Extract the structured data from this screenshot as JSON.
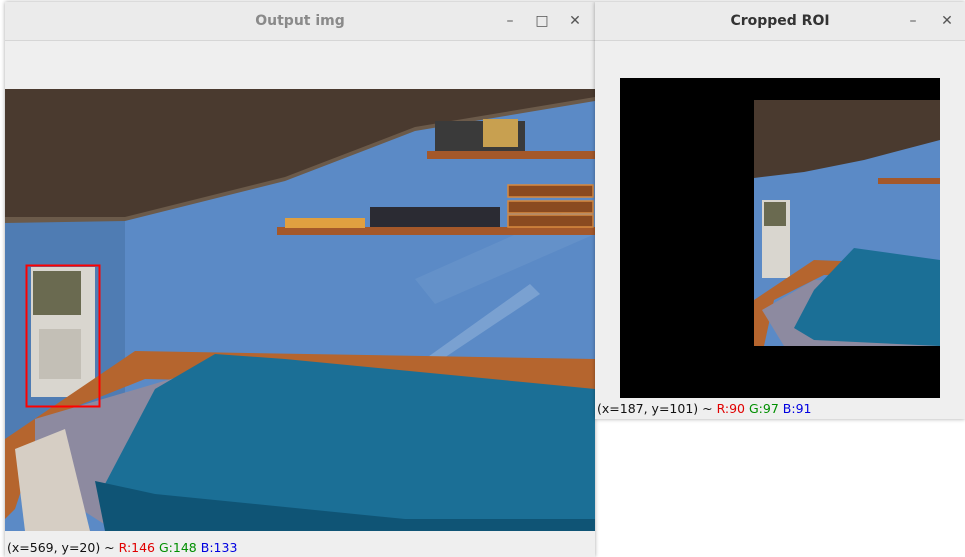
{
  "output_window": {
    "title": "Output img",
    "minimize_glyph": "–",
    "maximize_glyph": "□",
    "close_glyph": "✕",
    "status": {
      "coords": "(x=569, y=20) ~ ",
      "r": "R:146",
      "g": "G:148",
      "b": "B:133"
    },
    "roi_box_color": "#ff0000"
  },
  "roi_window": {
    "title": "Cropped ROI",
    "minimize_glyph": "–",
    "close_glyph": "✕",
    "status": {
      "coords": "(x=187, y=101) ~ ",
      "r": "R:90",
      "g": "G:97",
      "b": "B:91"
    }
  },
  "colors": {
    "wall": "#5a88c4",
    "ceiling": "#4a3a30",
    "blanket": "#1b6f95",
    "bed_frame": "#b5652e"
  }
}
